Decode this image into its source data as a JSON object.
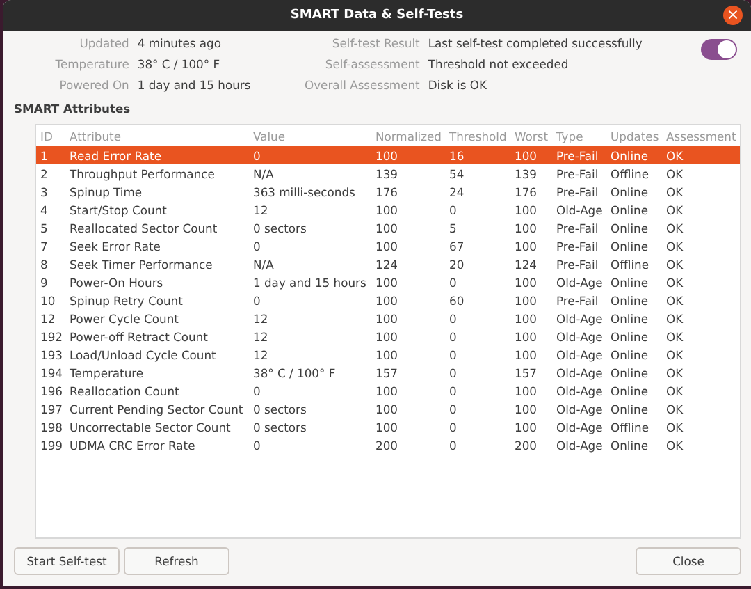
{
  "window": {
    "title": "SMART Data & Self-Tests",
    "close": "×"
  },
  "info_left": [
    {
      "label": "Updated",
      "value": "4 minutes ago"
    },
    {
      "label": "Temperature",
      "value": "38° C / 100° F"
    },
    {
      "label": "Powered On",
      "value": "1 day and 15 hours"
    }
  ],
  "info_right": [
    {
      "label": "Self-test Result",
      "value": "Last self-test completed successfully"
    },
    {
      "label": "Self-assessment",
      "value": "Threshold not exceeded"
    },
    {
      "label": "Overall Assessment",
      "value": "Disk is OK"
    }
  ],
  "toggle": {
    "on": true
  },
  "section_title": "SMART Attributes",
  "table": {
    "columns": [
      "ID",
      "Attribute",
      "Value",
      "Normalized",
      "Threshold",
      "Worst",
      "Type",
      "Updates",
      "Assessment"
    ],
    "rows": [
      {
        "selected": true,
        "cells": [
          "1",
          "Read Error Rate",
          "0",
          "100",
          "16",
          "100",
          "Pre-Fail",
          "Online",
          "OK"
        ]
      },
      {
        "selected": false,
        "cells": [
          "2",
          "Throughput Performance",
          "N/A",
          "139",
          "54",
          "139",
          "Pre-Fail",
          "Offline",
          "OK"
        ]
      },
      {
        "selected": false,
        "cells": [
          "3",
          "Spinup Time",
          "363 milli-seconds",
          "176",
          "24",
          "176",
          "Pre-Fail",
          "Online",
          "OK"
        ]
      },
      {
        "selected": false,
        "cells": [
          "4",
          "Start/Stop Count",
          "12",
          "100",
          "0",
          "100",
          "Old-Age",
          "Online",
          "OK"
        ]
      },
      {
        "selected": false,
        "cells": [
          "5",
          "Reallocated Sector Count",
          "0 sectors",
          "100",
          "5",
          "100",
          "Pre-Fail",
          "Online",
          "OK"
        ]
      },
      {
        "selected": false,
        "cells": [
          "7",
          "Seek Error Rate",
          "0",
          "100",
          "67",
          "100",
          "Pre-Fail",
          "Online",
          "OK"
        ]
      },
      {
        "selected": false,
        "cells": [
          "8",
          "Seek Timer Performance",
          "N/A",
          "124",
          "20",
          "124",
          "Pre-Fail",
          "Offline",
          "OK"
        ]
      },
      {
        "selected": false,
        "cells": [
          "9",
          "Power-On Hours",
          "1 day and 15 hours",
          "100",
          "0",
          "100",
          "Old-Age",
          "Online",
          "OK"
        ]
      },
      {
        "selected": false,
        "cells": [
          "10",
          "Spinup Retry Count",
          "0",
          "100",
          "60",
          "100",
          "Pre-Fail",
          "Online",
          "OK"
        ]
      },
      {
        "selected": false,
        "cells": [
          "12",
          "Power Cycle Count",
          "12",
          "100",
          "0",
          "100",
          "Old-Age",
          "Online",
          "OK"
        ]
      },
      {
        "selected": false,
        "cells": [
          "192",
          "Power-off Retract Count",
          "12",
          "100",
          "0",
          "100",
          "Old-Age",
          "Online",
          "OK"
        ]
      },
      {
        "selected": false,
        "cells": [
          "193",
          "Load/Unload Cycle Count",
          "12",
          "100",
          "0",
          "100",
          "Old-Age",
          "Online",
          "OK"
        ]
      },
      {
        "selected": false,
        "cells": [
          "194",
          "Temperature",
          "38° C / 100° F",
          "157",
          "0",
          "157",
          "Old-Age",
          "Online",
          "OK"
        ]
      },
      {
        "selected": false,
        "cells": [
          "196",
          "Reallocation Count",
          "0",
          "100",
          "0",
          "100",
          "Old-Age",
          "Online",
          "OK"
        ]
      },
      {
        "selected": false,
        "cells": [
          "197",
          "Current Pending Sector Count",
          "0 sectors",
          "100",
          "0",
          "100",
          "Old-Age",
          "Online",
          "OK"
        ]
      },
      {
        "selected": false,
        "cells": [
          "198",
          "Uncorrectable Sector Count",
          "0 sectors",
          "100",
          "0",
          "100",
          "Old-Age",
          "Offline",
          "OK"
        ]
      },
      {
        "selected": false,
        "cells": [
          "199",
          "UDMA CRC Error Rate",
          "0",
          "200",
          "0",
          "200",
          "Old-Age",
          "Online",
          "OK"
        ]
      }
    ]
  },
  "buttons_left": [
    "Start Self-test",
    "Refresh"
  ],
  "buttons_right": [
    "Close"
  ]
}
